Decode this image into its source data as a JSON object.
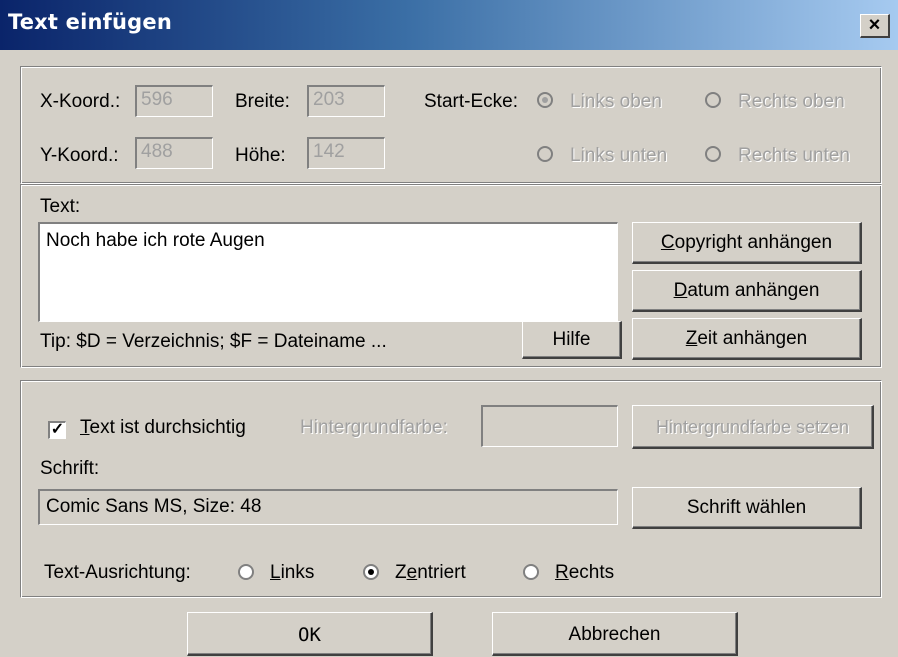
{
  "window": {
    "title": "Text einfügen",
    "close_label": "×"
  },
  "position": {
    "x_label": "X-Koord.:",
    "x_value": "596",
    "y_label": "Y-Koord.:",
    "y_value": "488",
    "width_label": "Breite:",
    "width_value": "203",
    "height_label": "Höhe:",
    "height_value": "142",
    "corner_label": "Start-Ecke:",
    "corners": [
      {
        "label": "Links oben",
        "checked": true
      },
      {
        "label": "Rechts oben",
        "checked": false
      },
      {
        "label": "Links unten",
        "checked": false
      },
      {
        "label": "Rechts unten",
        "checked": false
      }
    ]
  },
  "text_section": {
    "label": "Text:",
    "value": "Noch habe ich rote Augen",
    "tip": "Tip: $D = Verzeichnis; $F = Dateiname ...",
    "help_button": "Hilfe",
    "copyright_first": "C",
    "copyright_rest": "opyright anhängen",
    "date_first": "D",
    "date_rest": "atum anhängen",
    "time_first": "Z",
    "time_rest": "eit anhängen"
  },
  "style_section": {
    "transparent_checked": true,
    "transparent_first": "T",
    "transparent_rest": "ext ist durchsichtig",
    "bg_color_label": "Hintergrundfarbe:",
    "bg_color_button": "Hintergrundfarbe setzen",
    "font_label": "Schrift:",
    "font_value": "Comic Sans MS, Size: 48",
    "font_button": "Schrift wählen",
    "align_label": "Text-Ausrichtung:",
    "align_left_first": "L",
    "align_left_rest": "inks",
    "align_center_a": "Z",
    "align_center_u": "e",
    "align_center_rest": "ntriert",
    "align_right_first": "R",
    "align_right_rest": "echts",
    "align_selected": "center"
  },
  "footer": {
    "ok": "OK",
    "cancel": "Abbrechen"
  }
}
